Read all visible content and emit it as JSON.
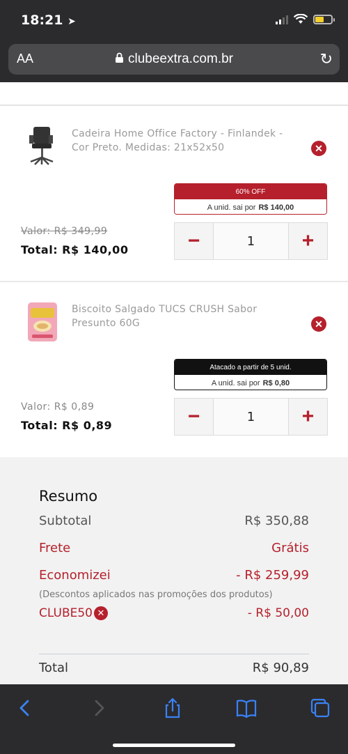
{
  "status": {
    "time": "18:21"
  },
  "browser": {
    "aa_label": "AA",
    "url": "clubeextra.com.br"
  },
  "products": [
    {
      "name": "Cadeira Home Office Factory - Finlandek - Cor Preto. Medidas: 21x52x50",
      "promo_title": "60% OFF",
      "promo_prefix": "A unid. sai por",
      "promo_price": "R$ 140,00",
      "old_price": "Valor: R$ 349,99",
      "total": "Total: R$ 140,00",
      "quantity": "1"
    },
    {
      "name": "Biscoito Salgado TUCS CRUSH Sabor Presunto 60G",
      "promo_title": "Atacado a partir de 5 unid.",
      "promo_prefix": "A unid. sai por",
      "promo_price": "R$ 0,80",
      "old_price": "Valor: R$ 0,89",
      "total": "Total: R$ 0,89",
      "quantity": "1"
    }
  ],
  "icons": {
    "minus": "minus-icon",
    "plus": "plus-icon",
    "remove": "close-icon"
  },
  "summary": {
    "title": "Resumo",
    "subtotal_label": "Subtotal",
    "subtotal_value": "R$ 350,88",
    "shipping_label": "Frete",
    "shipping_value": "Grátis",
    "saved_label": "Economizei",
    "saved_value": "- R$ 259,99",
    "note": "(Descontos aplicados nas promoções dos produtos)",
    "coupon_label": "CLUBE50",
    "coupon_value": "- R$ 50,00",
    "total_label": "Total",
    "total_value": "R$ 90,89"
  },
  "colors": {
    "accent": "#b5202c",
    "toolbar_icons": "#3a82f7"
  }
}
